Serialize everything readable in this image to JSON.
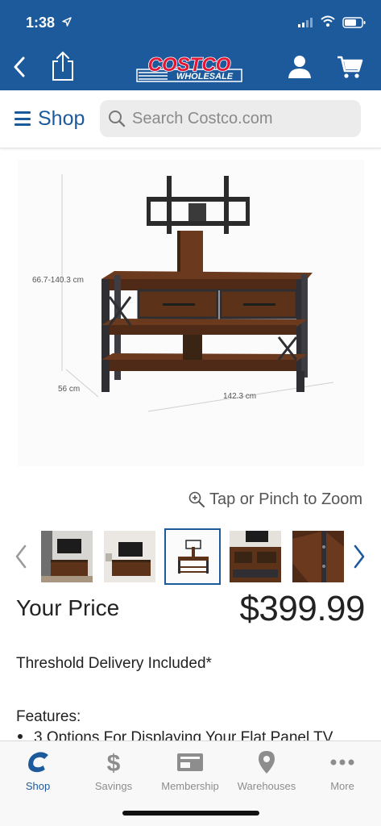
{
  "status_bar": {
    "time": "1:38"
  },
  "header": {
    "logo_text": "COSTCO",
    "logo_sub": "WHOLESALE"
  },
  "shopbar": {
    "shop_label": "Shop",
    "search_placeholder": "Search Costco.com"
  },
  "product_image": {
    "height_label": "66.7-140.3 cm",
    "depth_label": "56 cm",
    "width_label": "142.3 cm"
  },
  "zoom_hint": "Tap or Pinch to Zoom",
  "thumbnails": {
    "count": 5,
    "selected_index": 2
  },
  "price": {
    "label": "Your Price",
    "value": "$399.99"
  },
  "delivery": "Threshold Delivery Included*",
  "features": {
    "title": "Features:",
    "items": [
      "3 Options For Displaying Your Flat Panel TV"
    ]
  },
  "tabbar": {
    "items": [
      {
        "label": "Shop",
        "icon": "costco-c-icon",
        "active": true
      },
      {
        "label": "Savings",
        "icon": "dollar-icon",
        "active": false
      },
      {
        "label": "Membership",
        "icon": "membership-card-icon",
        "active": false
      },
      {
        "label": "Warehouses",
        "icon": "location-pin-icon",
        "active": false
      },
      {
        "label": "More",
        "icon": "more-dots-icon",
        "active": false
      }
    ]
  },
  "colors": {
    "brand_blue": "#1c5a9c",
    "logo_red": "#e31837"
  }
}
